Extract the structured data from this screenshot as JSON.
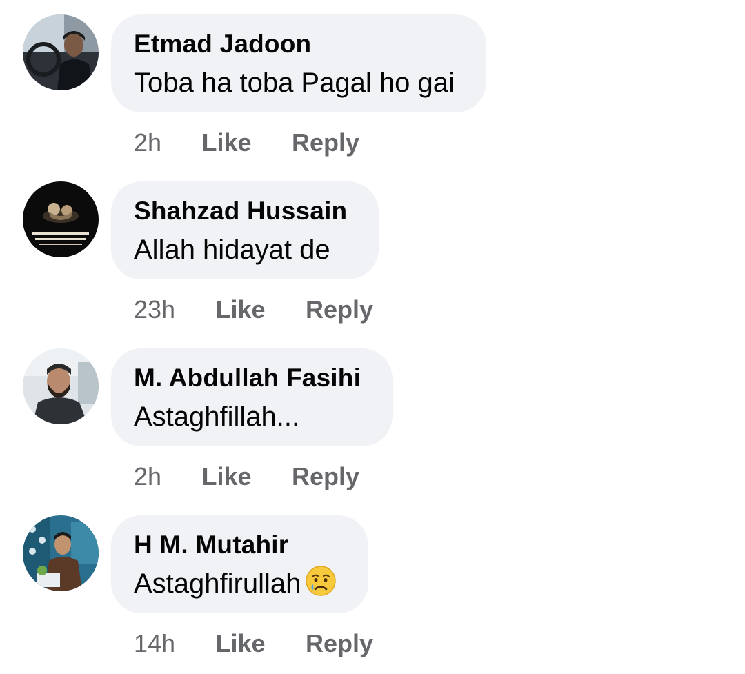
{
  "colors": {
    "bubble_bg": "#f0f2f5",
    "author_text": "#050505",
    "body_text": "#050505",
    "meta_text": "#65676b"
  },
  "comments": [
    {
      "author": "Etmad Jadoon",
      "text": "Toba ha toba Pagal ho gai",
      "time": "2h",
      "like_label": "Like",
      "reply_label": "Reply",
      "avatar_icon": "avatar-man-in-car"
    },
    {
      "author": "Shahzad Hussain",
      "text": "Allah hidayat de",
      "time": "23h",
      "like_label": "Like",
      "reply_label": "Reply",
      "avatar_icon": "avatar-dark-image-with-urdu-text"
    },
    {
      "author": "M. Abdullah Fasihi",
      "text": "Astaghfillah...",
      "time": "2h",
      "like_label": "Like",
      "reply_label": "Reply",
      "avatar_icon": "avatar-man-with-cap"
    },
    {
      "author": "H M. Mutahir",
      "text": "Astaghfirullah",
      "emoji": "sad-crying-face-emoji",
      "time": "14h",
      "like_label": "Like",
      "reply_label": "Reply",
      "avatar_icon": "avatar-man-in-studio"
    }
  ]
}
